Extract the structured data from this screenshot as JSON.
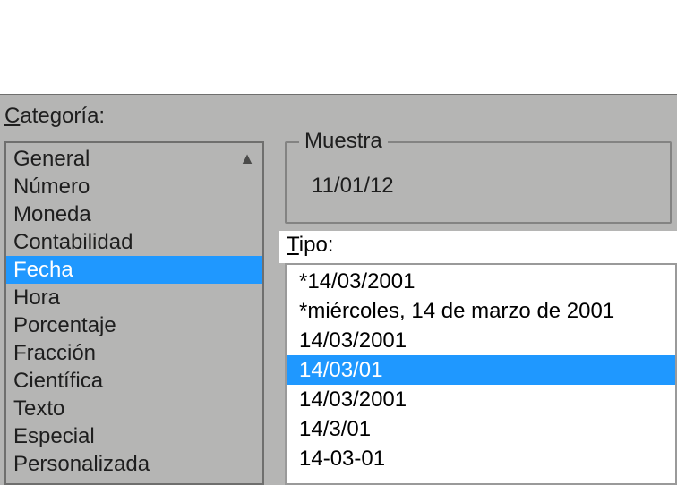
{
  "labels": {
    "categoria_prefix": "C",
    "categoria_rest": "ategoría:",
    "muestra": "Muestra",
    "tipo_prefix": "T",
    "tipo_rest": "ipo:"
  },
  "muestra_value": "11/01/12",
  "categorias": {
    "selected_index": 4,
    "items": [
      "General",
      "Número",
      "Moneda",
      "Contabilidad",
      "Fecha",
      "Hora",
      "Porcentaje",
      "Fracción",
      "Científica",
      "Texto",
      "Especial",
      "Personalizada"
    ]
  },
  "tipos": {
    "selected_index": 3,
    "items": [
      "*14/03/2001",
      "*miércoles, 14 de marzo de 2001",
      "14/03/2001",
      "14/03/01",
      "14/03/2001",
      "14/3/01",
      "14-03-01"
    ]
  }
}
